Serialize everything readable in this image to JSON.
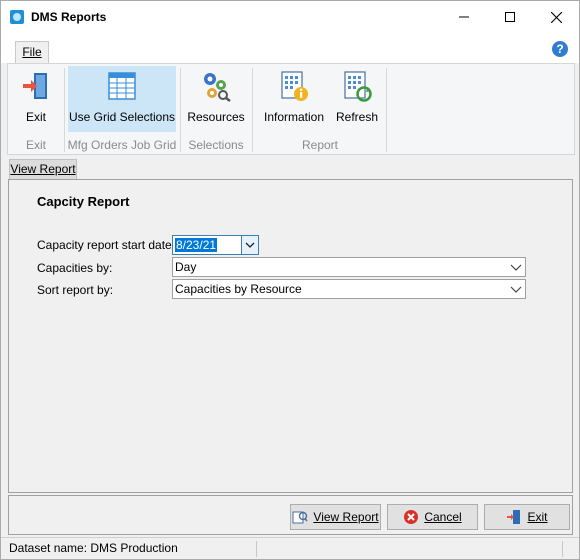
{
  "window": {
    "title": "DMS Reports",
    "controls": {
      "minimize": "minimize",
      "maximize": "maximize",
      "close": "close"
    }
  },
  "ribbon": {
    "file_tab": "File",
    "buttons": {
      "exit": "Exit",
      "use_grid": "Use Grid Selections",
      "resources": "Resources",
      "information": "Information",
      "refresh": "Refresh"
    },
    "groups": {
      "exit": "Exit",
      "mfg": "Mfg Orders Job Grid",
      "selections": "Selections",
      "report": "Report"
    }
  },
  "subtab": {
    "label": "View Report"
  },
  "form": {
    "title": "Capcity Report",
    "start_date_label": "Capacity report start date:",
    "start_date_value": "8/23/21",
    "capacities_by_label": "Capacities by:",
    "capacities_by_value": "Day",
    "sort_by_label": "Sort report by:",
    "sort_by_value": "Capacities by Resource"
  },
  "actions": {
    "view_report": "View Report",
    "cancel": "Cancel",
    "exit": "Exit"
  },
  "status": {
    "dataset": "Dataset name:  DMS Production"
  },
  "colors": {
    "selected_ribbon": "#cde6f7",
    "selection_highlight": "#0078d7",
    "help_blue": "#2f7dd1"
  }
}
